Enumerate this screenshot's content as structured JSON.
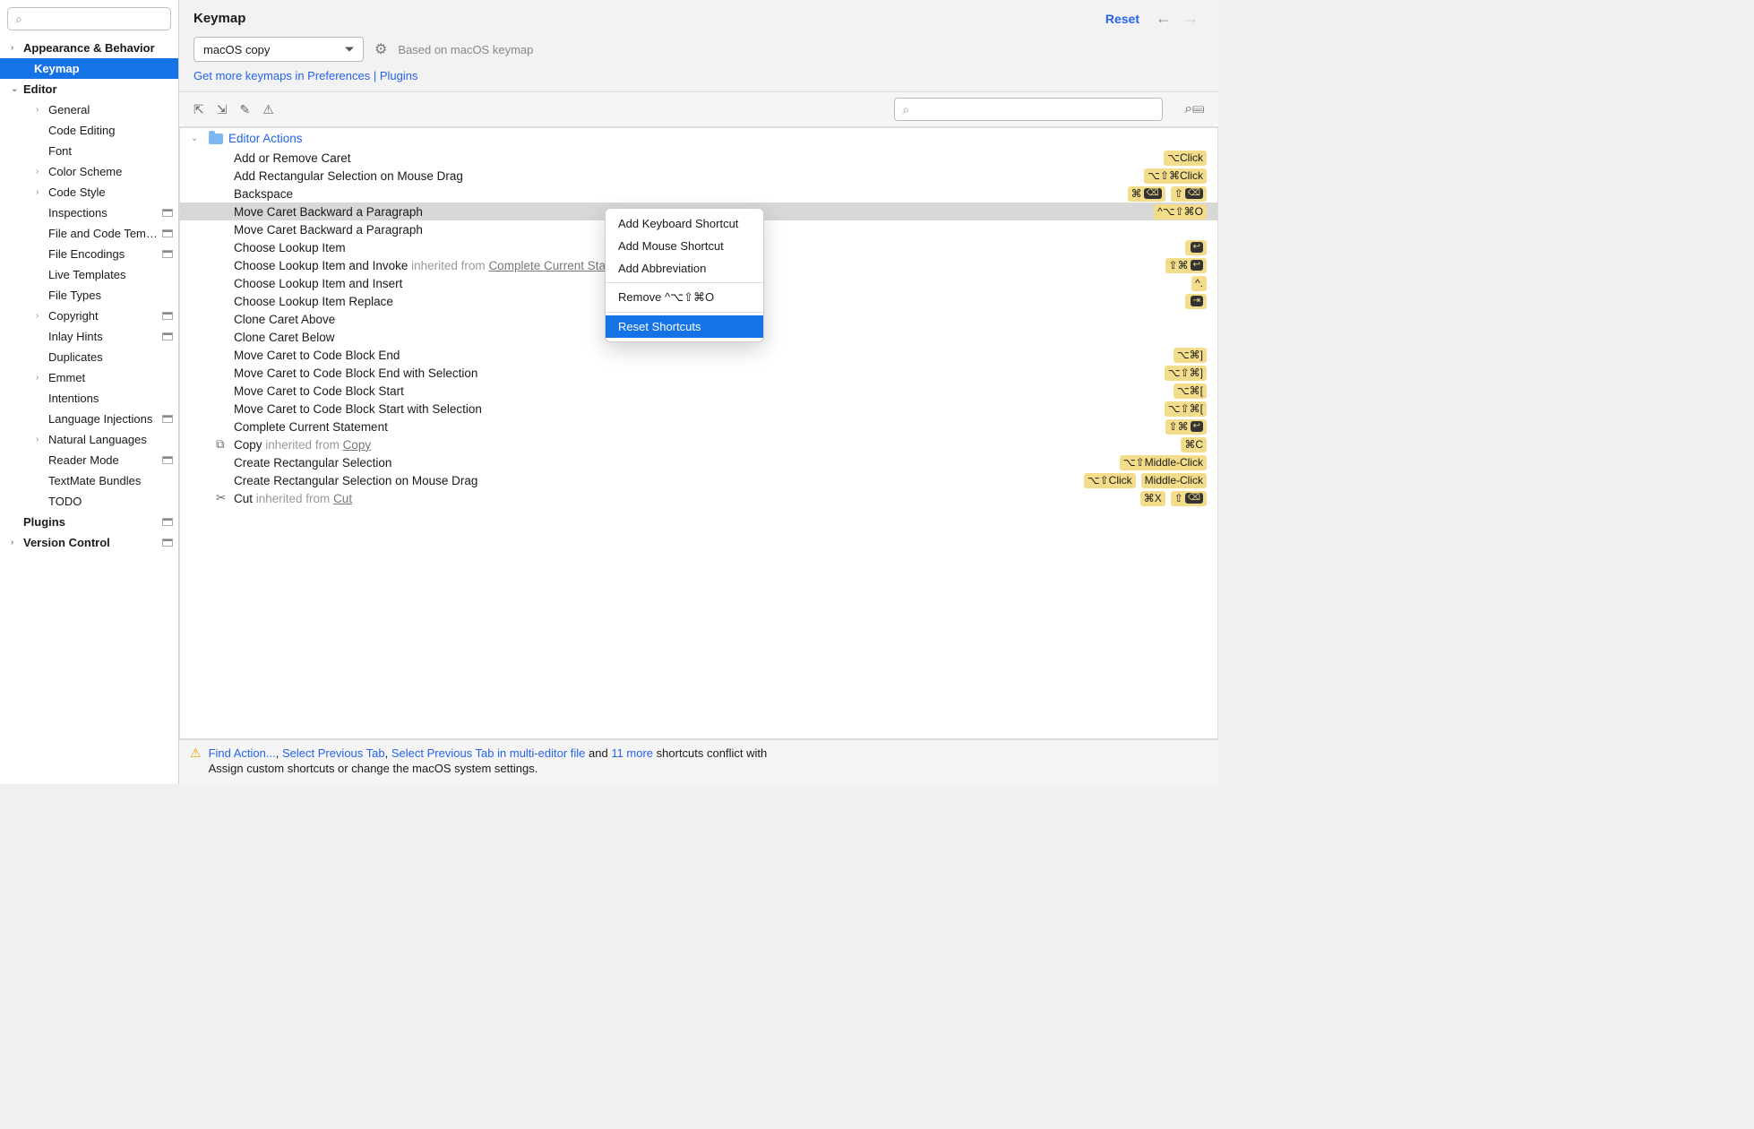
{
  "page_title": "Keymap",
  "header": {
    "reset": "Reset"
  },
  "keymap": {
    "selected": "macOS copy",
    "based_on": "Based on macOS keymap",
    "get_more": "Get more keymaps in Preferences | Plugins"
  },
  "sidebar": {
    "items": [
      {
        "label": "Appearance & Behavior",
        "bold": true,
        "chev": "›",
        "indent": 0
      },
      {
        "label": "Keymap",
        "bold": true,
        "indent": 1,
        "selected": true
      },
      {
        "label": "Editor",
        "bold": true,
        "chev": "⌄",
        "indent": 0
      },
      {
        "label": "General",
        "chev": "›",
        "indent": 2
      },
      {
        "label": "Code Editing",
        "indent": 2
      },
      {
        "label": "Font",
        "indent": 2
      },
      {
        "label": "Color Scheme",
        "chev": "›",
        "indent": 2
      },
      {
        "label": "Code Style",
        "chev": "›",
        "indent": 2
      },
      {
        "label": "Inspections",
        "indent": 2,
        "schema": true
      },
      {
        "label": "File and Code Templates",
        "indent": 2,
        "schema": true
      },
      {
        "label": "File Encodings",
        "indent": 2,
        "schema": true
      },
      {
        "label": "Live Templates",
        "indent": 2
      },
      {
        "label": "File Types",
        "indent": 2
      },
      {
        "label": "Copyright",
        "chev": "›",
        "indent": 2,
        "schema": true
      },
      {
        "label": "Inlay Hints",
        "indent": 2,
        "schema": true
      },
      {
        "label": "Duplicates",
        "indent": 2
      },
      {
        "label": "Emmet",
        "chev": "›",
        "indent": 2
      },
      {
        "label": "Intentions",
        "indent": 2
      },
      {
        "label": "Language Injections",
        "indent": 2,
        "schema": true
      },
      {
        "label": "Natural Languages",
        "chev": "›",
        "indent": 2
      },
      {
        "label": "Reader Mode",
        "indent": 2,
        "schema": true
      },
      {
        "label": "TextMate Bundles",
        "indent": 2
      },
      {
        "label": "TODO",
        "indent": 2
      },
      {
        "label": "Plugins",
        "bold": true,
        "indent": 0,
        "schema": true
      },
      {
        "label": "Version Control",
        "bold": true,
        "chev": "›",
        "indent": 0,
        "schema": true
      }
    ]
  },
  "group": {
    "name": "Editor Actions"
  },
  "actions": [
    {
      "label": "Add or Remove Caret",
      "sc": [
        "⌥Click"
      ]
    },
    {
      "label": "Add Rectangular Selection on Mouse Drag",
      "sc": [
        "⌥⇧⌘Click"
      ]
    },
    {
      "label": "Backspace",
      "sc": [
        "⌘<span class='kbx'>⌫</span>",
        "⇧<span class='kbx'>⌫</span>"
      ]
    },
    {
      "label": "Move Caret Backward a Paragraph",
      "sc": [
        "^⌥⇧⌘O"
      ],
      "selected": true
    },
    {
      "label": "Move Caret Backward a Paragraph"
    },
    {
      "label": "Choose Lookup Item",
      "sc": [
        "<span class='kbx'>↩</span>"
      ]
    },
    {
      "label": "Choose Lookup Item and Invoke",
      "inh": "Complete Current Statement",
      "sc": [
        "⇧⌘<span class='kbx'>↩</span>"
      ]
    },
    {
      "label": "Choose Lookup Item and Insert",
      "sc": [
        "^."
      ]
    },
    {
      "label": "Choose Lookup Item Replace",
      "sc": [
        "<span class='kbx'>⇥</span>"
      ]
    },
    {
      "label": "Clone Caret Above"
    },
    {
      "label": "Clone Caret Below"
    },
    {
      "label": "Move Caret to Code Block End",
      "sc": [
        "⌥⌘]"
      ]
    },
    {
      "label": "Move Caret to Code Block End with Selection",
      "sc": [
        "⌥⇧⌘]"
      ]
    },
    {
      "label": "Move Caret to Code Block Start",
      "sc": [
        "⌥⌘["
      ]
    },
    {
      "label": "Move Caret to Code Block Start with Selection",
      "sc": [
        "⌥⇧⌘["
      ]
    },
    {
      "label": "Complete Current Statement",
      "sc": [
        "⇧⌘<span class='kbx'>↩</span>"
      ]
    },
    {
      "label": "Copy",
      "inh": "Copy",
      "sc": [
        "⌘C"
      ],
      "icon": "⧉"
    },
    {
      "label": "Create Rectangular Selection",
      "sc": [
        "⌥⇧Middle-Click"
      ]
    },
    {
      "label": "Create Rectangular Selection on Mouse Drag",
      "sc": [
        "⌥⇧Click",
        "Middle-Click"
      ]
    },
    {
      "label": "Cut",
      "inh": "Cut",
      "sc": [
        "⌘X",
        "⇧<span class='kbx'>⌫</span>"
      ],
      "icon": "✂"
    }
  ],
  "context_menu": {
    "items": [
      "Add Keyboard Shortcut",
      "Add Mouse Shortcut",
      "Add Abbreviation",
      "-",
      "Remove ^⌥⇧⌘O",
      "-",
      "Reset Shortcuts"
    ],
    "selected_index": 6
  },
  "footer": {
    "links": [
      "Find Action...",
      "Select Previous Tab",
      "Select Previous Tab in multi-editor file"
    ],
    "and_more": "11 more",
    "tail1": " shortcuts conflict with",
    "line2": "Assign custom shortcuts or change the macOS system settings."
  }
}
